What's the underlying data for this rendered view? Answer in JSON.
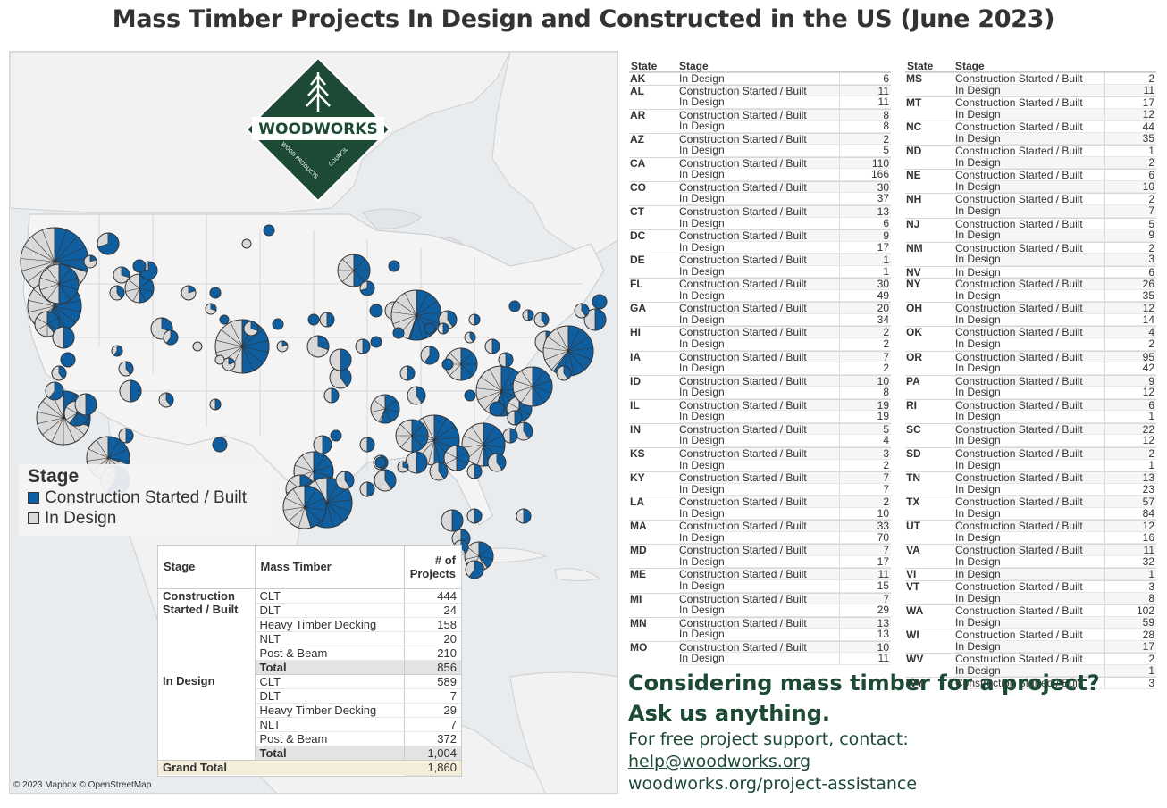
{
  "title": "Mass Timber Projects In Design and Constructed in the US (June 2023)",
  "colors": {
    "built": "#0f5fa0",
    "design": "#d9d9d9",
    "brand_green": "#1c4a35"
  },
  "map": {
    "attribution": "© 2023 Mapbox © OpenStreetMap",
    "logo": {
      "name": "WOODWORKS",
      "subtitle": "WOOD PRODUCTS COUNCIL"
    },
    "legend": {
      "title": "Stage",
      "items": [
        {
          "label": "Construction Started / Built",
          "color": "#0f5fa0"
        },
        {
          "label": "In Design",
          "color": "#d9d9d9"
        }
      ]
    }
  },
  "summary": {
    "headers": {
      "stage": "Stage",
      "mass_timber": "Mass Timber",
      "projects": "# of Projects"
    },
    "groups": [
      {
        "stage": "Construction Started / Built",
        "rows": [
          {
            "type": "CLT",
            "value": "444"
          },
          {
            "type": "DLT",
            "value": "24"
          },
          {
            "type": "Heavy Timber Decking",
            "value": "158"
          },
          {
            "type": "NLT",
            "value": "20"
          },
          {
            "type": "Post & Beam",
            "value": "210"
          }
        ],
        "total_label": "Total",
        "total": "856"
      },
      {
        "stage": "In Design",
        "rows": [
          {
            "type": "CLT",
            "value": "589"
          },
          {
            "type": "DLT",
            "value": "7"
          },
          {
            "type": "Heavy Timber Decking",
            "value": "29"
          },
          {
            "type": "NLT",
            "value": "7"
          },
          {
            "type": "Post & Beam",
            "value": "372"
          }
        ],
        "total_label": "Total",
        "total": "1,004"
      }
    ],
    "grand_total_label": "Grand Total",
    "grand_total": "1,860"
  },
  "state_table_headers": {
    "state": "State",
    "stage": "Stage"
  },
  "state_tables": [
    [
      {
        "state": "AK",
        "rows": [
          [
            "In Design",
            "6"
          ]
        ]
      },
      {
        "state": "AL",
        "rows": [
          [
            "Construction Started / Built",
            "11"
          ],
          [
            "In Design",
            "11"
          ]
        ]
      },
      {
        "state": "AR",
        "rows": [
          [
            "Construction Started / Built",
            "8"
          ],
          [
            "In Design",
            "8"
          ]
        ]
      },
      {
        "state": "AZ",
        "rows": [
          [
            "Construction Started / Built",
            "2"
          ],
          [
            "In Design",
            "5"
          ]
        ]
      },
      {
        "state": "CA",
        "rows": [
          [
            "Construction Started / Built",
            "110"
          ],
          [
            "In Design",
            "166"
          ]
        ]
      },
      {
        "state": "CO",
        "rows": [
          [
            "Construction Started / Built",
            "30"
          ],
          [
            "In Design",
            "37"
          ]
        ]
      },
      {
        "state": "CT",
        "rows": [
          [
            "Construction Started / Built",
            "13"
          ],
          [
            "In Design",
            "6"
          ]
        ]
      },
      {
        "state": "DC",
        "rows": [
          [
            "Construction Started / Built",
            "9"
          ],
          [
            "In Design",
            "17"
          ]
        ]
      },
      {
        "state": "DE",
        "rows": [
          [
            "Construction Started / Built",
            "1"
          ],
          [
            "In Design",
            "1"
          ]
        ]
      },
      {
        "state": "FL",
        "rows": [
          [
            "Construction Started / Built",
            "30"
          ],
          [
            "In Design",
            "49"
          ]
        ]
      },
      {
        "state": "GA",
        "rows": [
          [
            "Construction Started / Built",
            "20"
          ],
          [
            "In Design",
            "34"
          ]
        ]
      },
      {
        "state": "HI",
        "rows": [
          [
            "Construction Started / Built",
            "2"
          ],
          [
            "In Design",
            "2"
          ]
        ]
      },
      {
        "state": "IA",
        "rows": [
          [
            "Construction Started / Built",
            "7"
          ],
          [
            "In Design",
            "2"
          ]
        ]
      },
      {
        "state": "ID",
        "rows": [
          [
            "Construction Started / Built",
            "10"
          ],
          [
            "In Design",
            "8"
          ]
        ]
      },
      {
        "state": "IL",
        "rows": [
          [
            "Construction Started / Built",
            "19"
          ],
          [
            "In Design",
            "19"
          ]
        ]
      },
      {
        "state": "IN",
        "rows": [
          [
            "Construction Started / Built",
            "5"
          ],
          [
            "In Design",
            "4"
          ]
        ]
      },
      {
        "state": "KS",
        "rows": [
          [
            "Construction Started / Built",
            "3"
          ],
          [
            "In Design",
            "2"
          ]
        ]
      },
      {
        "state": "KY",
        "rows": [
          [
            "Construction Started / Built",
            "7"
          ],
          [
            "In Design",
            "7"
          ]
        ]
      },
      {
        "state": "LA",
        "rows": [
          [
            "Construction Started / Built",
            "2"
          ],
          [
            "In Design",
            "10"
          ]
        ]
      },
      {
        "state": "MA",
        "rows": [
          [
            "Construction Started / Built",
            "33"
          ],
          [
            "In Design",
            "70"
          ]
        ]
      },
      {
        "state": "MD",
        "rows": [
          [
            "Construction Started / Built",
            "7"
          ],
          [
            "In Design",
            "17"
          ]
        ]
      },
      {
        "state": "ME",
        "rows": [
          [
            "Construction Started / Built",
            "11"
          ],
          [
            "In Design",
            "15"
          ]
        ]
      },
      {
        "state": "MI",
        "rows": [
          [
            "Construction Started / Built",
            "7"
          ],
          [
            "In Design",
            "29"
          ]
        ]
      },
      {
        "state": "MN",
        "rows": [
          [
            "Construction Started / Built",
            "13"
          ],
          [
            "In Design",
            "13"
          ]
        ]
      },
      {
        "state": "MO",
        "rows": [
          [
            "Construction Started / Built",
            "10"
          ],
          [
            "In Design",
            "11"
          ]
        ]
      }
    ],
    [
      {
        "state": "MS",
        "rows": [
          [
            "Construction Started / Built",
            "2"
          ],
          [
            "In Design",
            "11"
          ]
        ]
      },
      {
        "state": "MT",
        "rows": [
          [
            "Construction Started / Built",
            "17"
          ],
          [
            "In Design",
            "12"
          ]
        ]
      },
      {
        "state": "NC",
        "rows": [
          [
            "Construction Started / Built",
            "44"
          ],
          [
            "In Design",
            "35"
          ]
        ]
      },
      {
        "state": "ND",
        "rows": [
          [
            "Construction Started / Built",
            "1"
          ],
          [
            "In Design",
            "2"
          ]
        ]
      },
      {
        "state": "NE",
        "rows": [
          [
            "Construction Started / Built",
            "6"
          ],
          [
            "In Design",
            "10"
          ]
        ]
      },
      {
        "state": "NH",
        "rows": [
          [
            "Construction Started / Built",
            "2"
          ],
          [
            "In Design",
            "7"
          ]
        ]
      },
      {
        "state": "NJ",
        "rows": [
          [
            "Construction Started / Built",
            "5"
          ],
          [
            "In Design",
            "9"
          ]
        ]
      },
      {
        "state": "NM",
        "rows": [
          [
            "Construction Started / Built",
            "2"
          ],
          [
            "In Design",
            "3"
          ]
        ]
      },
      {
        "state": "NV",
        "rows": [
          [
            "In Design",
            "6"
          ]
        ]
      },
      {
        "state": "NY",
        "rows": [
          [
            "Construction Started / Built",
            "26"
          ],
          [
            "In Design",
            "35"
          ]
        ]
      },
      {
        "state": "OH",
        "rows": [
          [
            "Construction Started / Built",
            "12"
          ],
          [
            "In Design",
            "14"
          ]
        ]
      },
      {
        "state": "OK",
        "rows": [
          [
            "Construction Started / Built",
            "4"
          ],
          [
            "In Design",
            "2"
          ]
        ]
      },
      {
        "state": "OR",
        "rows": [
          [
            "Construction Started / Built",
            "95"
          ],
          [
            "In Design",
            "42"
          ]
        ]
      },
      {
        "state": "PA",
        "rows": [
          [
            "Construction Started / Built",
            "9"
          ],
          [
            "In Design",
            "12"
          ]
        ]
      },
      {
        "state": "RI",
        "rows": [
          [
            "Construction Started / Built",
            "6"
          ],
          [
            "In Design",
            "1"
          ]
        ]
      },
      {
        "state": "SC",
        "rows": [
          [
            "Construction Started / Built",
            "22"
          ],
          [
            "In Design",
            "12"
          ]
        ]
      },
      {
        "state": "SD",
        "rows": [
          [
            "Construction Started / Built",
            "2"
          ],
          [
            "In Design",
            "1"
          ]
        ]
      },
      {
        "state": "TN",
        "rows": [
          [
            "Construction Started / Built",
            "13"
          ],
          [
            "In Design",
            "23"
          ]
        ]
      },
      {
        "state": "TX",
        "rows": [
          [
            "Construction Started / Built",
            "57"
          ],
          [
            "In Design",
            "84"
          ]
        ]
      },
      {
        "state": "UT",
        "rows": [
          [
            "Construction Started / Built",
            "12"
          ],
          [
            "In Design",
            "16"
          ]
        ]
      },
      {
        "state": "VA",
        "rows": [
          [
            "Construction Started / Built",
            "11"
          ],
          [
            "In Design",
            "32"
          ]
        ]
      },
      {
        "state": "VI",
        "rows": [
          [
            "In Design",
            "1"
          ]
        ]
      },
      {
        "state": "VT",
        "rows": [
          [
            "Construction Started / Built",
            "3"
          ],
          [
            "In Design",
            "8"
          ]
        ]
      },
      {
        "state": "WA",
        "rows": [
          [
            "Construction Started / Built",
            "102"
          ],
          [
            "In Design",
            "59"
          ]
        ]
      },
      {
        "state": "WI",
        "rows": [
          [
            "Construction Started / Built",
            "28"
          ],
          [
            "In Design",
            "17"
          ]
        ]
      },
      {
        "state": "WV",
        "rows": [
          [
            "Construction Started / Built",
            "2"
          ],
          [
            "In Design",
            "1"
          ]
        ]
      },
      {
        "state": "WY",
        "rows": [
          [
            "Construction Started / Built",
            "3"
          ]
        ]
      }
    ]
  ],
  "cta": {
    "heading1": "Considering mass timber for a project?",
    "heading2": "Ask us anything.",
    "line1": "For free project support, contact:",
    "email": "help@woodworks.org",
    "link": "woodworks.org/project-assistance"
  }
}
